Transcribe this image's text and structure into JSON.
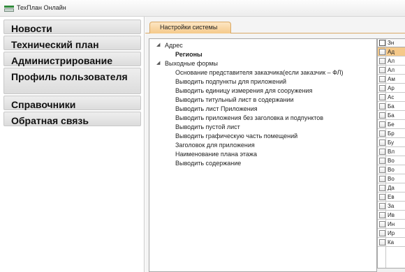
{
  "window": {
    "title": "ТехПлан Онлайн",
    "icon": "app-icon"
  },
  "sidebar": {
    "items": [
      {
        "label": "Новости"
      },
      {
        "label": "Технический план"
      },
      {
        "label": "Администрирование"
      },
      {
        "label": "Профиль пользователя"
      },
      {
        "label": "Справочники"
      },
      {
        "label": "Обратная связь"
      }
    ]
  },
  "tabs": [
    {
      "label": "Настройки системы",
      "active": true
    }
  ],
  "tree": {
    "root1": {
      "label": "Адрес",
      "expanded": true
    },
    "root1_children": [
      {
        "label": "Регионы",
        "bold": true
      }
    ],
    "root2": {
      "label": "Выходные формы",
      "expanded": true
    },
    "root2_children": [
      {
        "label": "Основание представителя заказчика(если заказчик – ФЛ)"
      },
      {
        "label": "Выводить подпункты для приложений"
      },
      {
        "label": "Выводить единицу измерения для сооружения"
      },
      {
        "label": "Выводить титульный лист в содержании"
      },
      {
        "label": "Выводить лист Приложения"
      },
      {
        "label": "Выводить приложения без заголовка и подпунктов"
      },
      {
        "label": "Выводить пустой лист"
      },
      {
        "label": "Выводить графическую часть помещений"
      },
      {
        "label": "Заголовок для приложения"
      },
      {
        "label": "Наименование плана этажа"
      },
      {
        "label": "Выводить содержание"
      }
    ]
  },
  "grid": {
    "header": "Зн",
    "rows": [
      {
        "text": "Ад",
        "selected": true
      },
      {
        "text": "Ал"
      },
      {
        "text": "Ал"
      },
      {
        "text": "Ам"
      },
      {
        "text": "Ар"
      },
      {
        "text": "Ас"
      },
      {
        "text": "Ба"
      },
      {
        "text": "Ба"
      },
      {
        "text": "Бе"
      },
      {
        "text": "Бр"
      },
      {
        "text": "Бу"
      },
      {
        "text": "Вл"
      },
      {
        "text": "Во"
      },
      {
        "text": "Во"
      },
      {
        "text": "Во"
      },
      {
        "text": "Да"
      },
      {
        "text": "Ев"
      },
      {
        "text": "За"
      },
      {
        "text": "Ив"
      },
      {
        "text": "Ин"
      },
      {
        "text": "Ир"
      },
      {
        "text": "Ка"
      }
    ]
  },
  "colors": {
    "tab_accent": "#f5c98a",
    "selected_row": "#f5c98a"
  }
}
